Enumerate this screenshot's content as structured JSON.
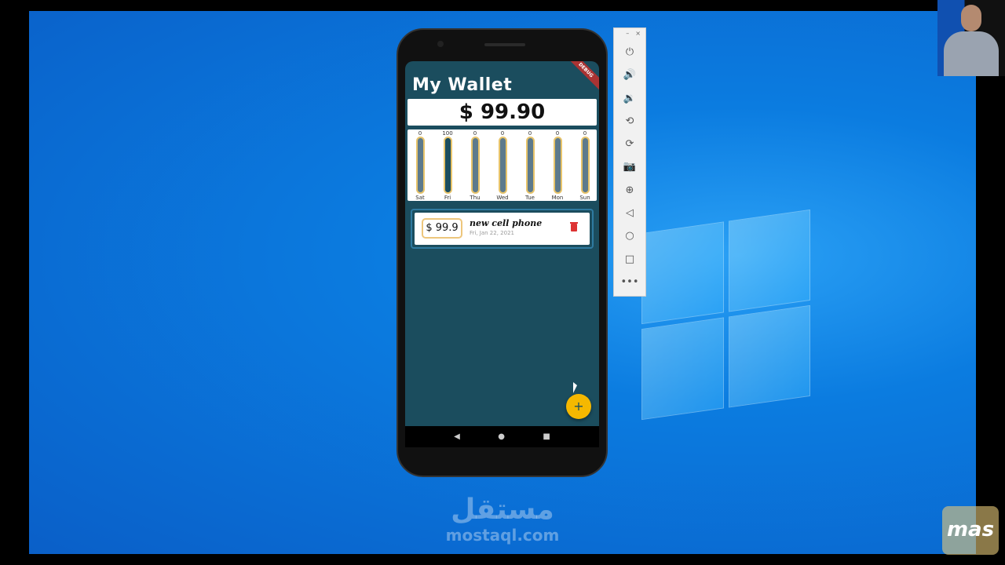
{
  "app": {
    "title": "My Wallet",
    "total": "$ 99.90",
    "debug_banner": "DEBUG"
  },
  "chart_data": {
    "type": "bar",
    "categories": [
      "Sat",
      "Fri",
      "Thu",
      "Wed",
      "Tue",
      "Mon",
      "Sun"
    ],
    "values": [
      0,
      100,
      0,
      0,
      0,
      0,
      0
    ],
    "value_labels": [
      "0",
      "100",
      "0",
      "0",
      "0",
      "0",
      "0"
    ],
    "ylim": [
      0,
      100
    ]
  },
  "transactions": [
    {
      "amount": "$ 99.9",
      "title": "new cell phone",
      "date": "Fri, Jan 22, 2021"
    }
  ],
  "fab": {
    "label": "+"
  },
  "android_nav": {
    "back": "◀",
    "home": "●",
    "recents": "■"
  },
  "emulator_toolbar": {
    "minimize": "–",
    "close": "×",
    "items": [
      {
        "icon": "power-icon",
        "glyph": "⏻"
      },
      {
        "icon": "volume-up-icon",
        "glyph": "🔊"
      },
      {
        "icon": "volume-down-icon",
        "glyph": "🔉"
      },
      {
        "icon": "rotate-left-icon",
        "glyph": "⟲"
      },
      {
        "icon": "rotate-right-icon",
        "glyph": "⟳"
      },
      {
        "icon": "camera-icon",
        "glyph": "📷"
      },
      {
        "icon": "zoom-icon",
        "glyph": "⊕"
      },
      {
        "icon": "back-icon",
        "glyph": "◁"
      },
      {
        "icon": "home-icon",
        "glyph": "○"
      },
      {
        "icon": "overview-icon",
        "glyph": "□"
      },
      {
        "icon": "more-icon",
        "glyph": "•••"
      }
    ]
  },
  "watermark": {
    "arabic": "مستقل",
    "latin": "mostaql.com"
  },
  "corner_logo": "mas",
  "colors": {
    "app_bg": "#1b4d5e",
    "accent": "#f5b800",
    "bar_border": "#e8c46a",
    "delete": "#d33333"
  }
}
